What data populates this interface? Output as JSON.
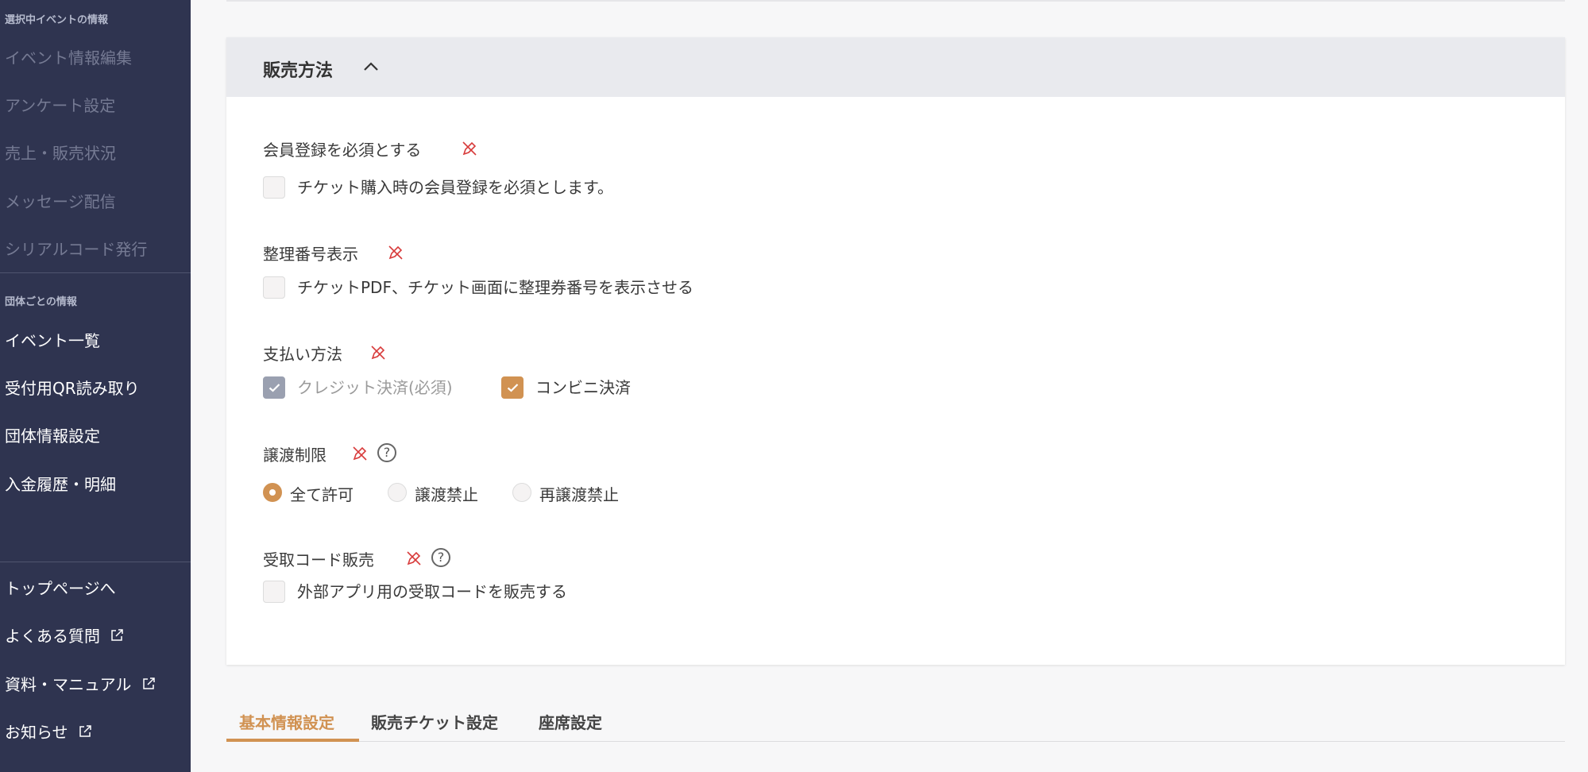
{
  "colors": {
    "sidebar_bg": "#2f3450",
    "accent": "#d19252",
    "header_bg": "#e9eaee",
    "pen_icon": "#d83b3b"
  },
  "sidebar": {
    "event_section_title": "選択中イベントの情報",
    "event_items": [
      "イベント情報編集",
      "アンケート設定",
      "売上・販売状況",
      "メッセージ配信",
      "シリアルコード発行"
    ],
    "org_section_title": "団体ごとの情報",
    "org_items": [
      "イベント一覧",
      "受付用QR読み取り",
      "団体情報設定",
      "入金履歴・明細"
    ],
    "footer_items": [
      {
        "label": "トップページへ",
        "icon": ""
      },
      {
        "label": "よくある質問",
        "icon": "external-link-icon"
      },
      {
        "label": "資料・マニュアル",
        "icon": "external-link-icon"
      },
      {
        "label": "お知らせ",
        "icon": "external-link-icon"
      }
    ]
  },
  "sales_method": {
    "title": "販売方法",
    "header_icon": "chevron-up-icon",
    "membership": {
      "label": "会員登録を必須とする",
      "checkbox_label": "チケット購入時の会員登録を必須とします。",
      "checked": false
    },
    "numbering": {
      "label": "整理番号表示",
      "checkbox_label": "チケットPDF、チケット画面に整理券番号を表示させる",
      "checked": false
    },
    "payment": {
      "label": "支払い方法",
      "options": [
        {
          "label": "クレジット決済(必須)",
          "checked": true,
          "disabled": true
        },
        {
          "label": "コンビニ決済",
          "checked": true,
          "disabled": false
        }
      ]
    },
    "transfer": {
      "label": "譲渡制限",
      "help": "?",
      "options": [
        "全て許可",
        "譲渡禁止",
        "再譲渡禁止"
      ],
      "selected": "全て許可"
    },
    "receipt_code": {
      "label": "受取コード販売",
      "help": "?",
      "checkbox_label": "外部アプリ用の受取コードを販売する",
      "checked": false
    }
  },
  "tabs": [
    {
      "label": "基本情報設定",
      "active": true
    },
    {
      "label": "販売チケット設定",
      "active": false
    },
    {
      "label": "座席設定",
      "active": false
    }
  ]
}
